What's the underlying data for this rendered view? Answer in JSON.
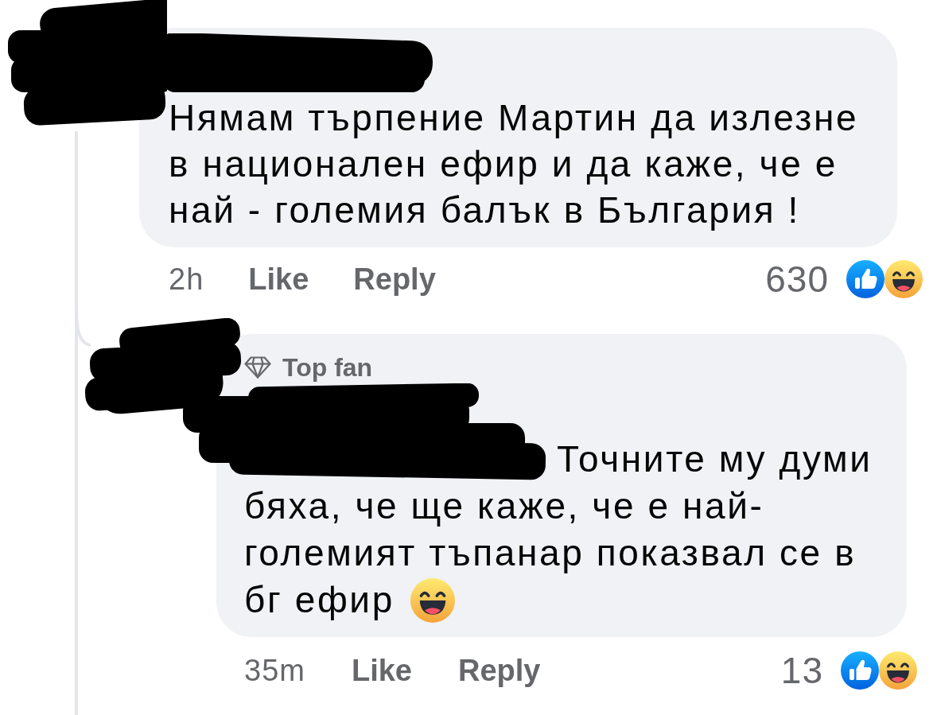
{
  "comment": {
    "text": "Нямам търпение Мартин да излезне\nв национален ефир и да каже, че е\nнай - големия балък в България !",
    "time": "2h",
    "actions": [
      "Like",
      "Reply"
    ],
    "reaction_count": "630",
    "replies": [
      {
        "badge": "Top fan",
        "text": "Точните му думи\nбяха, че ще каже, че е най-\nголемият тъпанар показвал се в\nбг ефир",
        "time": "35m",
        "actions": [
          "Like",
          "Reply"
        ],
        "reaction_count": "13"
      }
    ]
  }
}
